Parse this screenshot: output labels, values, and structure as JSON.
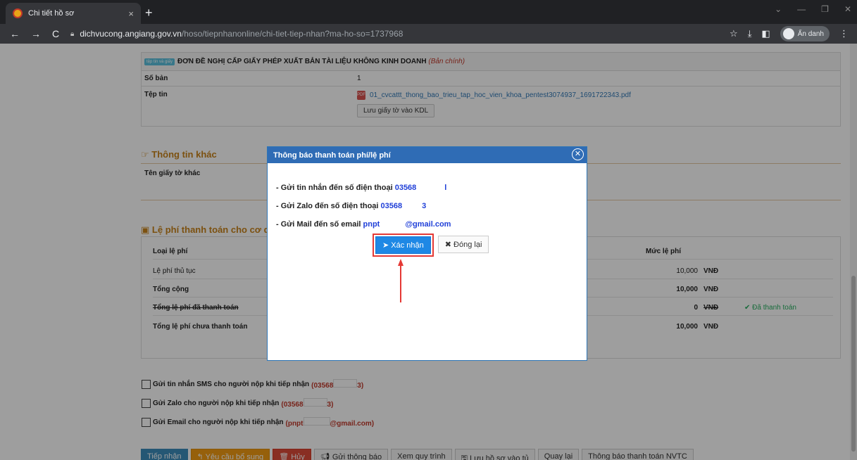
{
  "browser": {
    "tab_title": "Chi tiết hồ sơ",
    "tab_close": "×",
    "new_tab": "+",
    "url_host": "dichvucong.angiang.gov.vn",
    "url_path": "/hoso/tiepnhanonline/chi-tiet-tiep-nhan?ma-ho-so=1737968",
    "incognito_label": "Ẩn danh"
  },
  "document": {
    "tag": "tệp tin và giấy",
    "title": "ĐƠN ĐỀ NGHỊ CẤP GIẤY PHÉP XUẤT BẢN TÀI LIỆU KHÔNG KINH DOANH",
    "title_note": "(Bản chính)",
    "copies_label": "Số bản",
    "copies_value": "1",
    "file_label": "Tệp tin",
    "file_name": "01_cvcattt_thong_bao_trieu_tap_hoc_vien_khoa_pentest3074937_1691722343.pdf",
    "save_button": "Lưu giấy tờ vào KDL"
  },
  "other_info": {
    "heading": "Thông tin khác",
    "other_doc_label": "Tên giấy tờ khác"
  },
  "fees": {
    "heading": "Lệ phí thanh toán cho cơ qu",
    "col_type": "Loại lệ phí",
    "col_amount": "Mức lệ phí",
    "rows": [
      {
        "label": "Lệ phí thủ tục",
        "amount": "10,000",
        "currency": "VNĐ",
        "status": ""
      },
      {
        "label": "Tổng cộng",
        "amount": "10,000",
        "currency": "VNĐ",
        "status": ""
      },
      {
        "label": "Tổng lệ phí đã thanh toán",
        "amount": "0",
        "currency": "VNĐ",
        "status": "✔ Đã thanh toán"
      },
      {
        "label": "Tổng lệ phí chưa thanh toán",
        "amount": "10,000",
        "currency": "VNĐ",
        "status": ""
      }
    ]
  },
  "checkboxes": {
    "sms": "Gửi tin nhắn SMS cho người nộp khi tiếp nhận",
    "sms_value": "(03568",
    "sms_value_end": "3)",
    "zalo": "Gửi Zalo cho người nộp khi tiếp nhận",
    "zalo_value": "(03568",
    "zalo_value_end": "3)",
    "email": "Gửi Email cho người nộp khi tiếp nhận",
    "email_value": "(pnpt",
    "email_value_end": "@gmail.com)"
  },
  "actions": {
    "receive": "Tiếp nhận",
    "request_more": "Yêu cầu bổ sung",
    "cancel": "Hủy",
    "send_notice": "Gửi thông báo",
    "view_process": "Xem quy trình",
    "save_to_cabinet": "Lưu hồ sơ vào tủ",
    "back": "Quay lại",
    "payment_notice": "Thông báo thanh toán NVTC"
  },
  "modal": {
    "title": "Thông báo thanh toán phí/lệ phí",
    "line_sms": "- Gửi tin nhắn đến số điện thoại",
    "line_sms_value": "03568",
    "line_zalo": "- Gửi Zalo đến số điện thoại",
    "line_zalo_value": "03568",
    "line_mail": "- Gửi Mail đến số email",
    "line_mail_value_start": "pnpt",
    "line_mail_value_end": "@gmail.com",
    "confirm": "Xác nhận",
    "close": "Đóng lại"
  }
}
